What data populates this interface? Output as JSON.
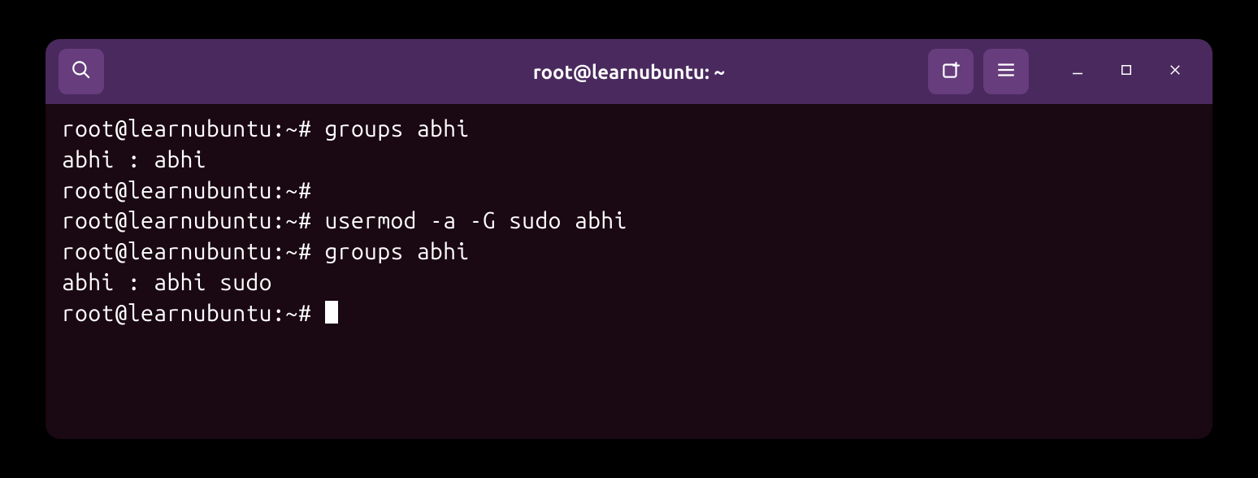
{
  "window": {
    "title": "root@learnubuntu: ~"
  },
  "terminal": {
    "lines": [
      "root@learnubuntu:~# groups abhi",
      "abhi : abhi",
      "root@learnubuntu:~#",
      "root@learnubuntu:~# usermod -a -G sudo abhi",
      "root@learnubuntu:~# groups abhi",
      "abhi : abhi sudo",
      "root@learnubuntu:~# "
    ]
  }
}
